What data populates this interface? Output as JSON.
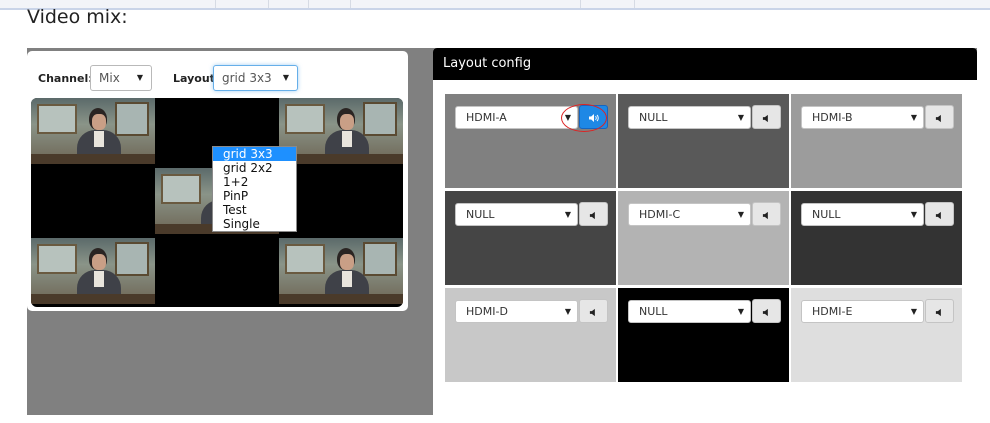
{
  "page": {
    "heading": "Video mix:"
  },
  "controls": {
    "channel_label": "Channel:",
    "channel_value": "Mix",
    "layout_label": "Layout:",
    "layout_value": "grid 3x3"
  },
  "layout_dropdown": {
    "options": [
      "grid 3x3",
      "grid 2x2",
      "1+2",
      "PinP",
      "Test",
      "Single"
    ],
    "selected_index": 0
  },
  "preview": {
    "grid": [
      [
        "video",
        "empty",
        "video"
      ],
      [
        "empty",
        "video",
        "empty"
      ],
      [
        "video",
        "empty",
        "video"
      ]
    ]
  },
  "layout_config": {
    "title": "Layout config",
    "cells": [
      {
        "source": "HDMI-A",
        "bg": "#808080",
        "audio_active": true,
        "highlighted": true
      },
      {
        "source": "NULL",
        "bg": "#595959",
        "audio_active": false,
        "highlighted": false
      },
      {
        "source": "HDMI-B",
        "bg": "#9c9c9c",
        "audio_active": false,
        "highlighted": false
      },
      {
        "source": "NULL",
        "bg": "#454545",
        "audio_active": false,
        "highlighted": false
      },
      {
        "source": "HDMI-C",
        "bg": "#b3b3b3",
        "audio_active": false,
        "highlighted": false
      },
      {
        "source": "NULL",
        "bg": "#333333",
        "audio_active": false,
        "highlighted": false
      },
      {
        "source": "HDMI-D",
        "bg": "#c8c8c8",
        "audio_active": false,
        "highlighted": false
      },
      {
        "source": "NULL",
        "bg": "#000000",
        "audio_active": false,
        "highlighted": false
      },
      {
        "source": "HDMI-E",
        "bg": "#dedede",
        "audio_active": false,
        "highlighted": false
      }
    ]
  },
  "colors": {
    "accent": "#1e90ff",
    "highlight_oval": "#dd2222",
    "workspace_bg": "#808080"
  }
}
